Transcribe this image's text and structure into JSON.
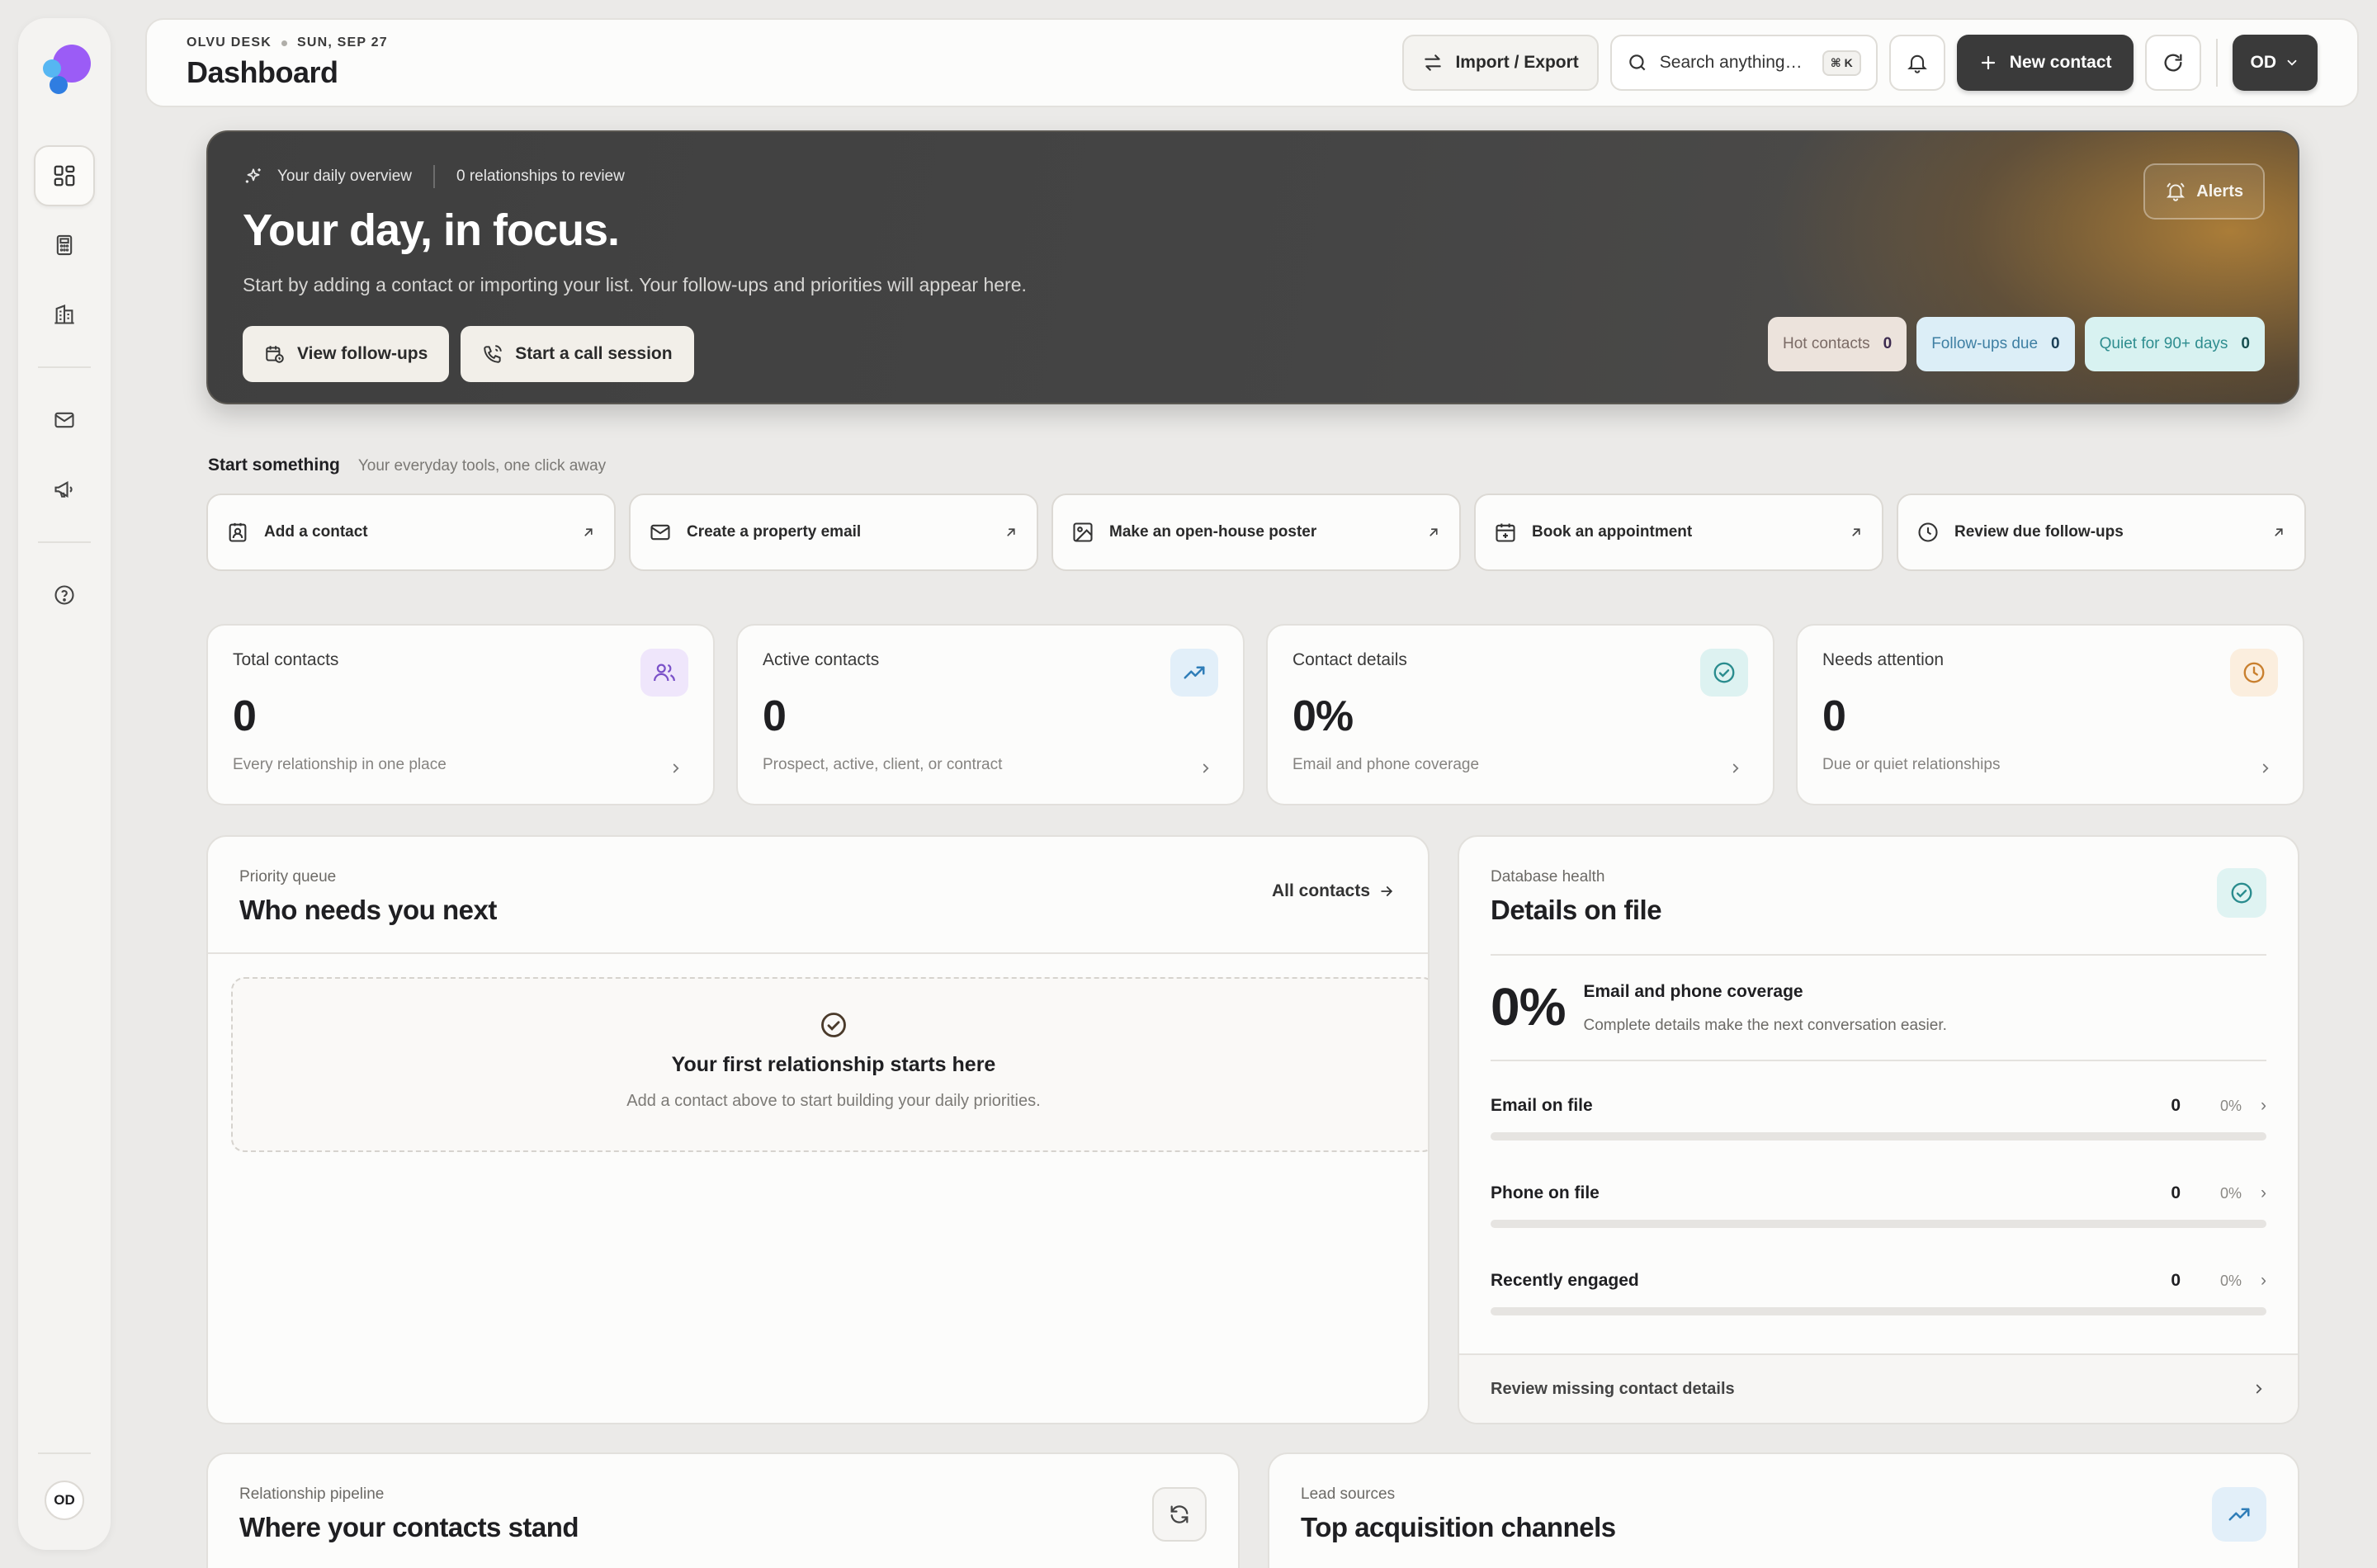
{
  "sidebar": {
    "avatar_initials": "OD",
    "items": [
      {
        "icon": "dashboard-icon",
        "active": true
      },
      {
        "icon": "calculator-icon",
        "active": false
      },
      {
        "icon": "building-icon",
        "active": false
      },
      {
        "icon": "mail-icon",
        "active": false
      },
      {
        "icon": "megaphone-icon",
        "active": false
      },
      {
        "icon": "help-icon",
        "active": false
      }
    ]
  },
  "header": {
    "brand": "OLVU DESK",
    "date": "SUN, SEP 27",
    "title": "Dashboard",
    "import_export_label": "Import / Export",
    "search_placeholder": "Search anything…",
    "search_shortcut": "⌘ K",
    "new_contact_label": "New contact",
    "account_initials": "OD"
  },
  "hero": {
    "overview_label": "Your daily overview",
    "review_count_text": "0 relationships to review",
    "title": "Your day, in focus.",
    "subtitle": "Start by adding a contact or importing your list. Your follow-ups and priorities will appear here.",
    "view_followups_label": "View follow-ups",
    "call_session_label": "Start a call session",
    "alerts_label": "Alerts",
    "chips": [
      {
        "label": "Hot contacts",
        "count": "0"
      },
      {
        "label": "Follow-ups due",
        "count": "0"
      },
      {
        "label": "Quiet for 90+ days",
        "count": "0"
      }
    ]
  },
  "start_something": {
    "title": "Start something",
    "subtitle": "Your everyday tools, one click away",
    "actions": [
      {
        "label": "Add a contact",
        "icon": "contact-card-icon"
      },
      {
        "label": "Create a property email",
        "icon": "mail-icon"
      },
      {
        "label": "Make an open-house poster",
        "icon": "image-icon"
      },
      {
        "label": "Book an appointment",
        "icon": "calendar-icon"
      },
      {
        "label": "Review due follow-ups",
        "icon": "clock-icon"
      }
    ]
  },
  "stats": [
    {
      "label": "Total contacts",
      "value": "0",
      "sub": "Every relationship in one place",
      "icon": "users-icon",
      "tint": "#efe6fb",
      "color": "#7b52c9"
    },
    {
      "label": "Active contacts",
      "value": "0",
      "sub": "Prospect, active, client, or contract",
      "icon": "trending-up-icon",
      "tint": "#e2eff9",
      "color": "#2f7db8"
    },
    {
      "label": "Contact details",
      "value": "0%",
      "sub": "Email and phone coverage",
      "icon": "check-circle-icon",
      "tint": "#ddf2f1",
      "color": "#2a8c8e"
    },
    {
      "label": "Needs attention",
      "value": "0",
      "sub": "Due or quiet relationships",
      "icon": "clock-icon",
      "tint": "#fbeede",
      "color": "#c9802f"
    }
  ],
  "priority_queue": {
    "eyebrow": "Priority queue",
    "title": "Who needs you next",
    "all_contacts_label": "All contacts",
    "empty_title": "Your first relationship starts here",
    "empty_sub": "Add a contact above to start building your daily priorities."
  },
  "database_health": {
    "eyebrow": "Database health",
    "title": "Details on file",
    "coverage_value": "0%",
    "coverage_title": "Email and phone coverage",
    "coverage_sub": "Complete details make the next conversation easier.",
    "metrics": [
      {
        "name": "Email on file",
        "count": "0",
        "percent": "0%",
        "fraction": 0
      },
      {
        "name": "Phone on file",
        "count": "0",
        "percent": "0%",
        "fraction": 0
      },
      {
        "name": "Recently engaged",
        "count": "0",
        "percent": "0%",
        "fraction": 0
      }
    ],
    "review_label": "Review missing contact details"
  },
  "pipeline": {
    "eyebrow": "Relationship pipeline",
    "title": "Where your contacts stand"
  },
  "lead_sources": {
    "eyebrow": "Lead sources",
    "title": "Top acquisition channels"
  },
  "colors": {
    "accent_dark": "#3a3a3a",
    "hero_gold": "#b08038",
    "teal": "#2f9a9d"
  }
}
